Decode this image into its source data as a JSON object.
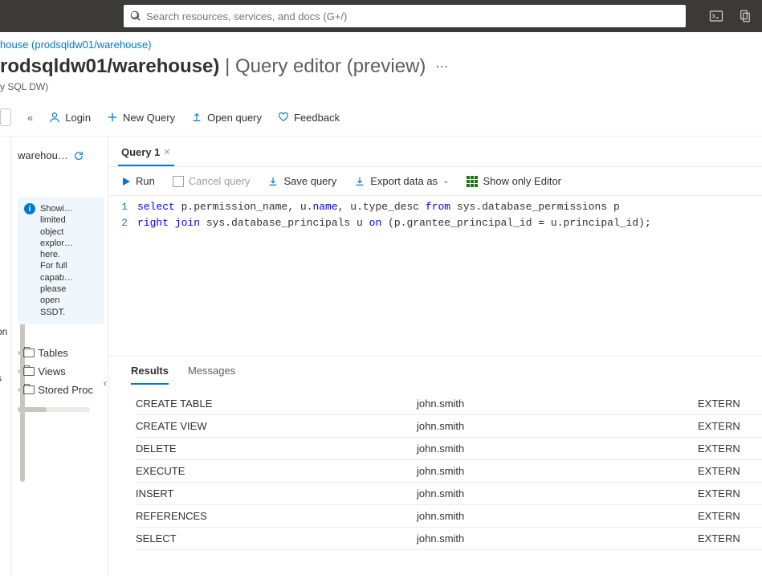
{
  "topbar": {
    "search_placeholder": "Search resources, services, and docs (G+/)"
  },
  "breadcrumb": {
    "text": "house (prodsqldw01/warehouse)"
  },
  "page": {
    "title_bold": "rodsqldw01/warehouse)",
    "title_thin": " | Query editor (preview)",
    "subtitle": "y SQL DW)"
  },
  "cmdbar": {
    "collapse_label": "«",
    "login": "Login",
    "new_query": "New Query",
    "open_query": "Open query",
    "feedback": "Feedback"
  },
  "explorer": {
    "label": "warehou…",
    "info_lines": [
      "Showi…",
      "limited",
      "object",
      "explor…",
      "here.",
      "For full",
      "capab…",
      "please",
      "open",
      "SSDT."
    ],
    "tree": {
      "tables": "Tables",
      "views": "Views",
      "sprocs": "Stored Proc"
    }
  },
  "leftnav_stub": {
    "item1": "on",
    "item2": "s"
  },
  "editor": {
    "tab_label": "Query 1",
    "toolbar": {
      "run": "Run",
      "cancel": "Cancel query",
      "save": "Save query",
      "export": "Export data as",
      "show_only": "Show only Editor"
    },
    "code": [
      {
        "ln": "1",
        "tokens": [
          {
            "t": "select",
            "c": "kw"
          },
          {
            "t": " p.permission_name, u.",
            "c": ""
          },
          {
            "t": "name",
            "c": "kw"
          },
          {
            "t": ", u.type_desc ",
            "c": ""
          },
          {
            "t": "from",
            "c": "kw"
          },
          {
            "t": " sys.database_permissions p",
            "c": ""
          }
        ]
      },
      {
        "ln": "2",
        "tokens": [
          {
            "t": "right join",
            "c": "kw"
          },
          {
            "t": " sys.database_principals u ",
            "c": ""
          },
          {
            "t": "on",
            "c": "kw"
          },
          {
            "t": " (p.grantee_principal_id ",
            "c": ""
          },
          {
            "t": "=",
            "c": "op"
          },
          {
            "t": " u.principal_id);",
            "c": ""
          }
        ]
      }
    ]
  },
  "results": {
    "tabs": {
      "results": "Results",
      "messages": "Messages"
    },
    "rows": [
      {
        "c1": "CREATE TABLE",
        "c2": "john.smith",
        "c3": "EXTERN"
      },
      {
        "c1": "CREATE VIEW",
        "c2": "john.smith",
        "c3": "EXTERN"
      },
      {
        "c1": "DELETE",
        "c2": "john.smith",
        "c3": "EXTERN"
      },
      {
        "c1": "EXECUTE",
        "c2": "john.smith",
        "c3": "EXTERN"
      },
      {
        "c1": "INSERT",
        "c2": "john.smith",
        "c3": "EXTERN"
      },
      {
        "c1": "REFERENCES",
        "c2": "john.smith",
        "c3": "EXTERN"
      },
      {
        "c1": "SELECT",
        "c2": "john.smith",
        "c3": "EXTERN"
      }
    ]
  }
}
